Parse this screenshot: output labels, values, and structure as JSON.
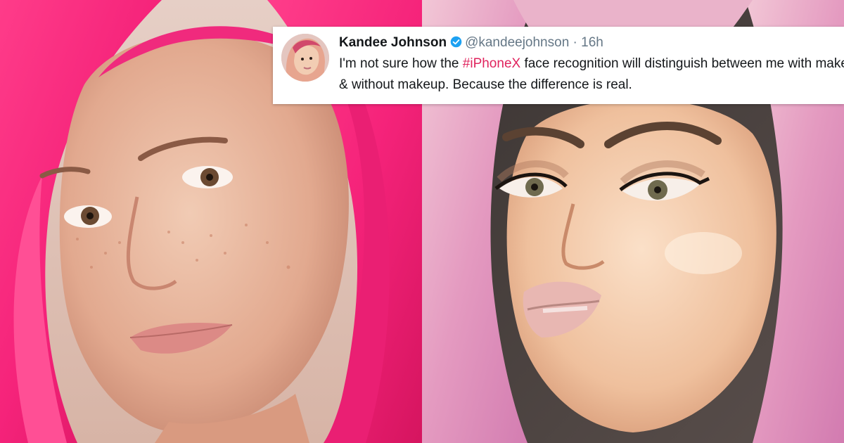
{
  "tweet": {
    "name": "Kandee Johnson",
    "handle": "@kandeejohnson",
    "separator": "·",
    "time": "16h",
    "text_before": "I'm not sure how the ",
    "hashtag": "#iPhoneX",
    "text_after": " face recognition will distinguish between me with makeup & without makeup. Because the difference is real.",
    "colors": {
      "hashtag": "#e0245e",
      "verified": "#1da1f2",
      "meta": "#657786"
    }
  },
  "images": {
    "left_photo": "woman-without-makeup-pink-hair",
    "right_photo": "woman-with-makeup-pastel-pink-hair"
  }
}
